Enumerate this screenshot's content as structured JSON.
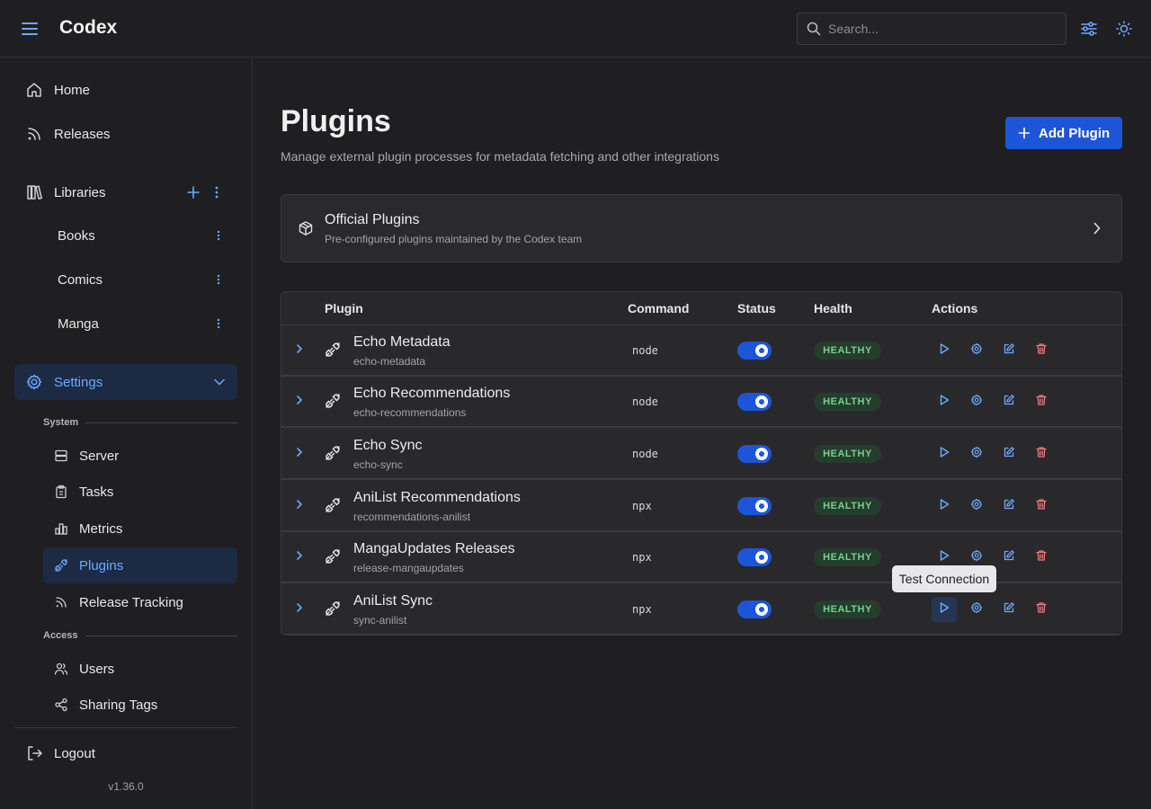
{
  "header": {
    "app_title": "Codex",
    "search_placeholder": "Search..."
  },
  "sidebar": {
    "home": "Home",
    "releases": "Releases",
    "libraries": "Libraries",
    "library_items": [
      "Books",
      "Comics",
      "Manga"
    ],
    "settings": "Settings",
    "system_label": "System",
    "system_items": [
      "Server",
      "Tasks",
      "Metrics",
      "Plugins",
      "Release Tracking"
    ],
    "access_label": "Access",
    "access_items": [
      "Users",
      "Sharing Tags"
    ],
    "logout": "Logout",
    "version": "v1.36.0"
  },
  "main": {
    "title": "Plugins",
    "subtitle": "Manage external plugin processes for metadata fetching and other integrations",
    "add_button": "Add Plugin",
    "official": {
      "title": "Official Plugins",
      "subtitle": "Pre-configured plugins maintained by the Codex team"
    },
    "columns": [
      "Plugin",
      "Command",
      "Status",
      "Health",
      "Actions"
    ],
    "rows": [
      {
        "name": "Echo Metadata",
        "slug": "echo-metadata",
        "command": "node",
        "enabled": true,
        "health": "HEALTHY"
      },
      {
        "name": "Echo Recommendations",
        "slug": "echo-recommendations",
        "command": "node",
        "enabled": true,
        "health": "HEALTHY"
      },
      {
        "name": "Echo Sync",
        "slug": "echo-sync",
        "command": "node",
        "enabled": true,
        "health": "HEALTHY"
      },
      {
        "name": "AniList Recommendations",
        "slug": "recommendations-anilist",
        "command": "npx",
        "enabled": true,
        "health": "HEALTHY"
      },
      {
        "name": "MangaUpdates Releases",
        "slug": "release-mangaupdates",
        "command": "npx",
        "enabled": true,
        "health": "HEALTHY"
      },
      {
        "name": "AniList Sync",
        "slug": "sync-anilist",
        "command": "npx",
        "enabled": true,
        "health": "HEALTHY"
      }
    ],
    "tooltip": "Test Connection"
  },
  "colors": {
    "accent": "#1d55d8",
    "accent_text": "#6ea8ff",
    "healthy_bg": "#253d2d",
    "healthy_text": "#76d08c",
    "delete": "#f07a7a"
  }
}
